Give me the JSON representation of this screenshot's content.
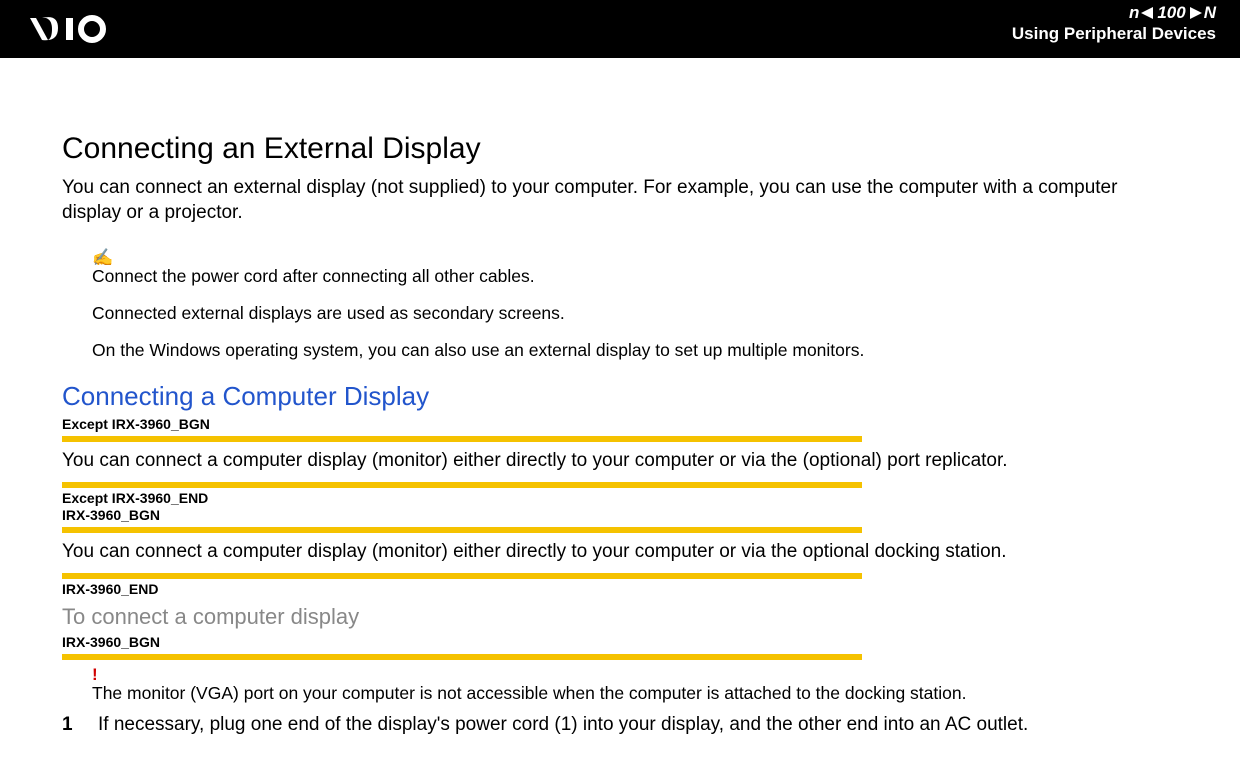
{
  "header": {
    "page_number": "100",
    "letter": "n",
    "N": "N",
    "chapter": "Using Peripheral Devices"
  },
  "main": {
    "h1": "Connecting an External Display",
    "intro": "You can connect an external display (not supplied) to your computer. For example, you can use the computer with a computer display or a projector.",
    "note_icon": "✍",
    "notes": [
      "Connect the power cord after connecting all other cables.",
      "Connected external displays are used as secondary screens.",
      "On the Windows operating system, you can also use an external display to set up multiple monitors."
    ],
    "h2": "Connecting a Computer Display",
    "tag1": "Except IRX-3960_BGN",
    "body1": "You can connect a computer display (monitor) either directly to your computer or via the (optional) port replicator.",
    "tag2a": "Except IRX-3960_END",
    "tag2b": "IRX-3960_BGN",
    "body2": "You can connect a computer display (monitor) either directly to your computer or via the optional docking station.",
    "tag3": "IRX-3960_END",
    "h3": "To connect a computer display",
    "tag4": "IRX-3960_BGN",
    "warn_icon": "!",
    "warn_text": "The monitor (VGA) port on your computer is not accessible when the computer is attached to the docking station.",
    "step1_num": "1",
    "step1_text": "If necessary, plug one end of the display's power cord (1) into your display, and the other end into an AC outlet."
  }
}
